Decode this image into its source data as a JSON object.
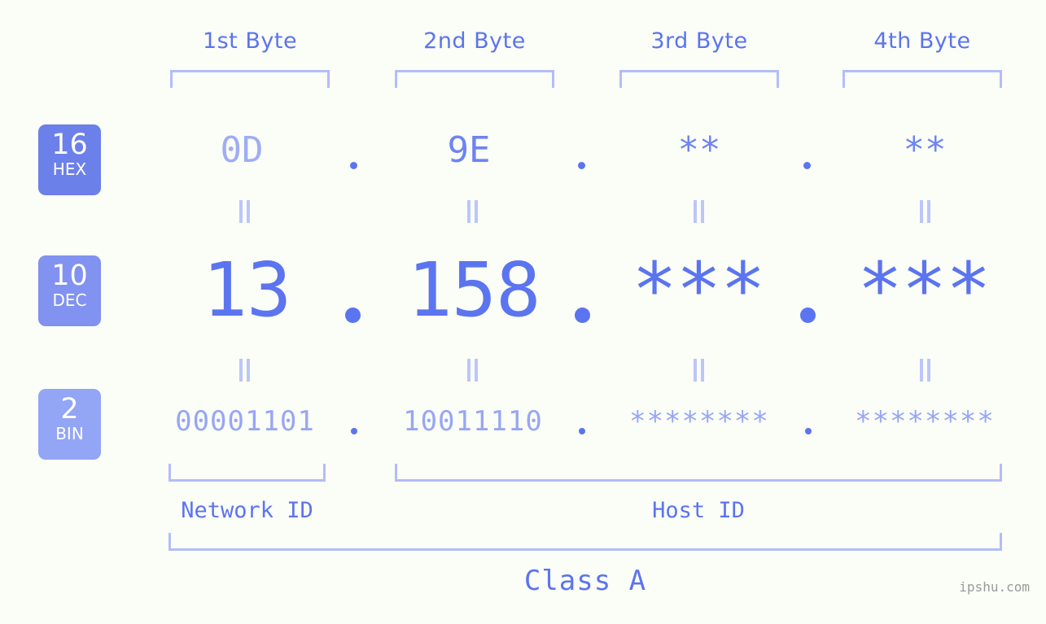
{
  "background_color": "#fbfdf7",
  "accent_color": "#5b74ef",
  "accent_light_color": "#9fadf6",
  "bracket_color": "#b3bdf8",
  "byte_headers": [
    {
      "label": "1st Byte"
    },
    {
      "label": "2nd Byte"
    },
    {
      "label": "3rd Byte"
    },
    {
      "label": "4th Byte"
    }
  ],
  "bases": [
    {
      "num": "16",
      "name": "HEX",
      "color": "#6c80e9"
    },
    {
      "num": "10",
      "name": "DEC",
      "color": "#8192f0"
    },
    {
      "num": "2",
      "name": "BIN",
      "color": "#93a5f5"
    }
  ],
  "rows": {
    "hex": {
      "values": [
        "0D",
        "9E",
        "**",
        "**"
      ],
      "masked": [
        false,
        false,
        true,
        true
      ]
    },
    "dec": {
      "values": [
        "13",
        "158",
        "***",
        "***"
      ],
      "masked": [
        false,
        false,
        true,
        true
      ]
    },
    "bin": {
      "values": [
        "00001101",
        "10011110",
        "********",
        "********"
      ],
      "masked": [
        false,
        false,
        true,
        true
      ]
    }
  },
  "separator": ".",
  "equality_mark": "=",
  "segments": {
    "network_id": "Network ID",
    "host_id": "Host ID"
  },
  "class_label": "Class A",
  "watermark": "ipshu.com"
}
